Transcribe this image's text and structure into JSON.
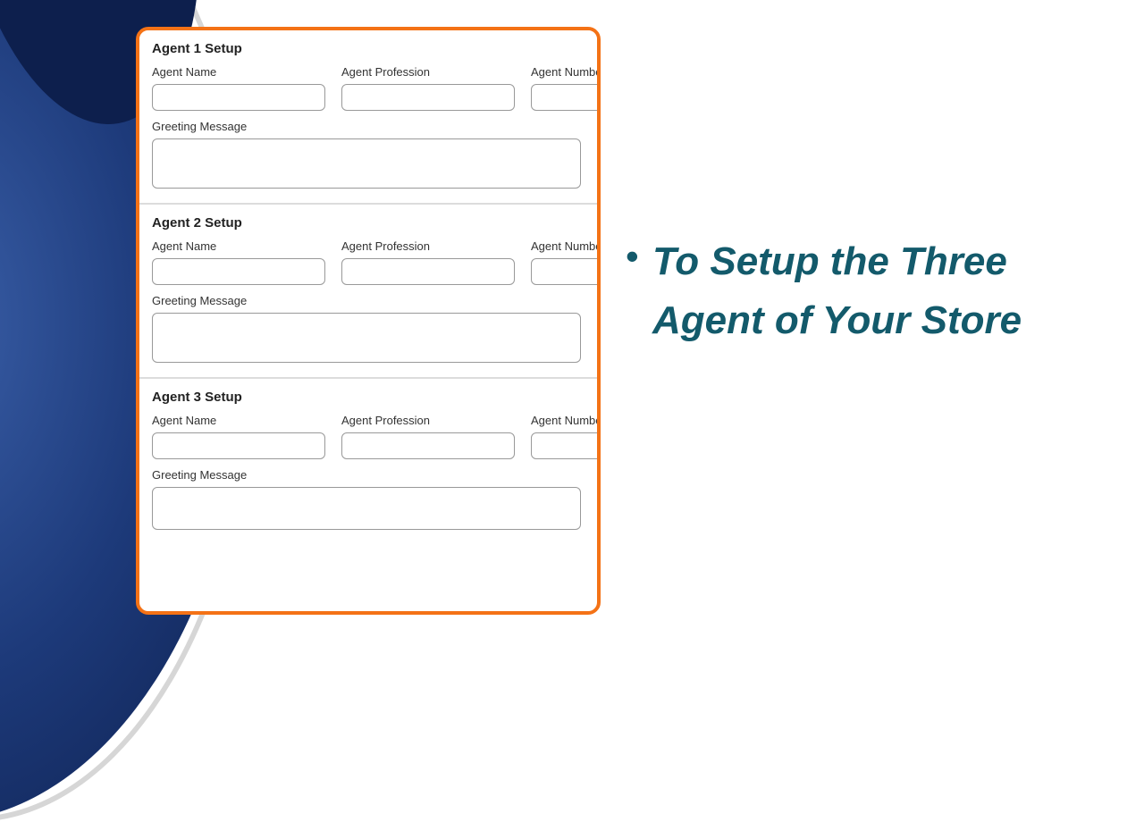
{
  "agents": [
    {
      "title": "Agent 1 Setup",
      "labels": {
        "name": "Agent Name",
        "profession": "Agent Profession",
        "number": "Agent Number",
        "greeting": "Greeting Message"
      },
      "values": {
        "name": "",
        "profession": "",
        "number": "",
        "greeting": ""
      }
    },
    {
      "title": "Agent 2 Setup",
      "labels": {
        "name": "Agent Name",
        "profession": "Agent Profession",
        "number": "Agent Number",
        "greeting": "Greeting Message"
      },
      "values": {
        "name": "",
        "profession": "",
        "number": "",
        "greeting": ""
      }
    },
    {
      "title": "Agent 3 Setup",
      "labels": {
        "name": "Agent Name",
        "profession": "Agent Profession",
        "number": "Agent Number",
        "greeting": "Greeting Message"
      },
      "values": {
        "name": "",
        "profession": "",
        "number": "",
        "greeting": ""
      }
    }
  ],
  "callout": {
    "items": [
      "To Setup the Three Agent of Your Store"
    ]
  }
}
